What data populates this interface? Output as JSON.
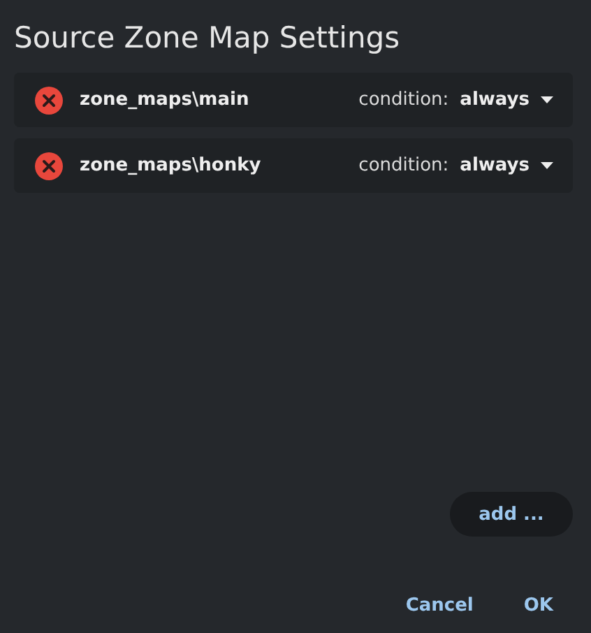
{
  "title": "Source Zone Map Settings",
  "maps": [
    {
      "path": "zone_maps\\main",
      "condition_label": "condition:",
      "condition": "always"
    },
    {
      "path": "zone_maps\\honky",
      "condition_label": "condition:",
      "condition": "always"
    }
  ],
  "add_button": "add ...",
  "buttons": [
    "Cancel",
    "OK"
  ]
}
